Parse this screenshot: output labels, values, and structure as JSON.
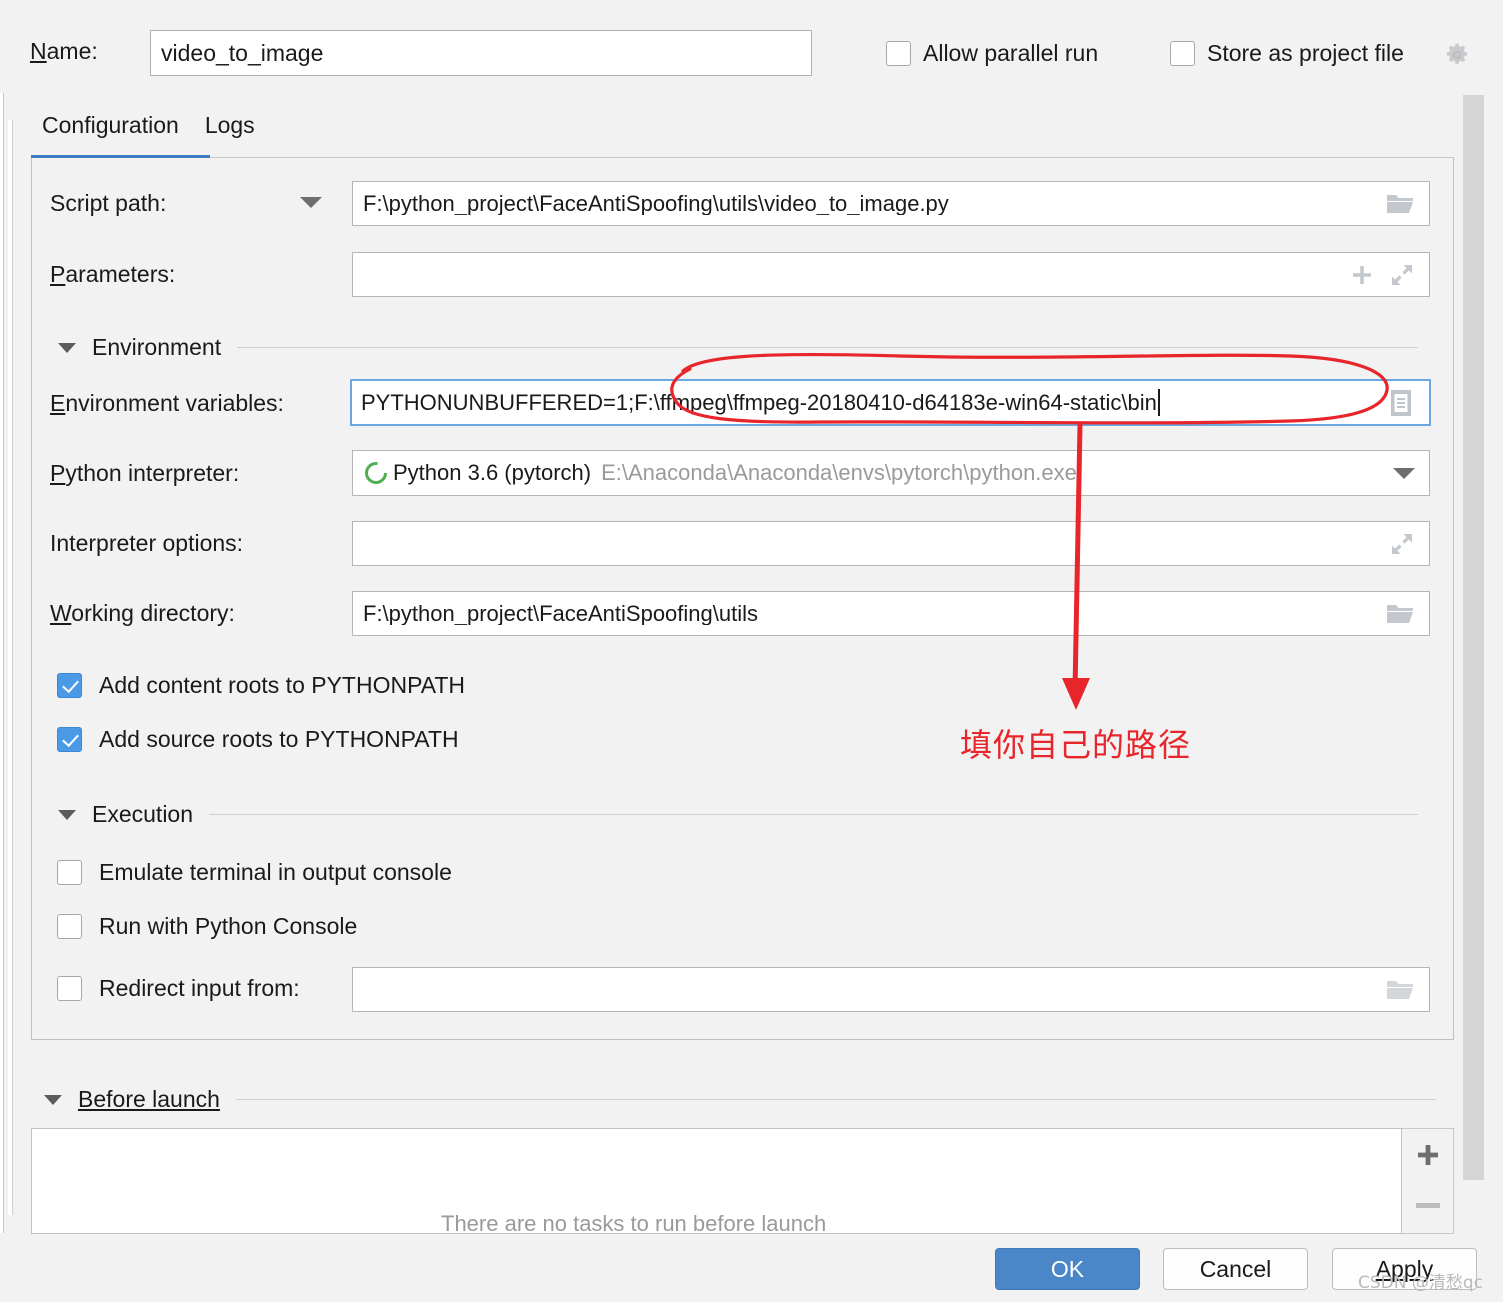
{
  "dialog": {
    "name_label": "Name:",
    "name_value": "video_to_image",
    "allow_parallel_run": "Allow parallel run",
    "store_as_project_file": "Store as project file",
    "gear_icon": "gear-icon"
  },
  "tabs": [
    {
      "label": "Configuration",
      "active": true
    },
    {
      "label": "Logs",
      "active": false
    }
  ],
  "fields": {
    "script_path_label": "Script path:",
    "script_path_value": "F:\\python_project\\FaceAntiSpoofing\\utils\\video_to_image.py",
    "parameters_label": "Parameters:",
    "parameters_value": "",
    "env_vars_label": "Environment variables:",
    "env_vars_value": "PYTHONUNBUFFERED=1;F:\\ffmpeg\\ffmpeg-20180410-d64183e-win64-static\\bin",
    "interpreter_label": "Python interpreter:",
    "interpreter_name": "Python 3.6 (pytorch)",
    "interpreter_path": "E:\\Anaconda\\Anaconda\\envs\\pytorch\\python.exe",
    "interpreter_options_label": "Interpreter options:",
    "interpreter_options_value": "",
    "working_directory_label": "Working directory:",
    "working_directory_value": "F:\\python_project\\FaceAntiSpoofing\\utils",
    "redirect_input_label": "Redirect input from:",
    "redirect_input_value": ""
  },
  "sections": {
    "environment": "Environment",
    "execution": "Execution",
    "before_launch": "Before launch"
  },
  "checkboxes": {
    "add_content_roots": {
      "label": "Add content roots to PYTHONPATH",
      "checked": true
    },
    "add_source_roots": {
      "label": "Add source roots to PYTHONPATH",
      "checked": true
    },
    "emulate_terminal": {
      "label": "Emulate terminal in output console",
      "checked": false
    },
    "run_with_python_console": {
      "label": "Run with Python Console",
      "checked": false
    }
  },
  "before_launch": {
    "ghost_text": "There are no tasks to run before launch"
  },
  "buttons": {
    "ok": "OK",
    "cancel": "Cancel",
    "apply": "Apply"
  },
  "annotations": {
    "note_text": "填你自己的路径",
    "note_color": "#e8252a",
    "watermark": "CSDN @清愁qc"
  },
  "colors": {
    "accent": "#3d7dc0",
    "ok_button": "#4a86c8",
    "checkbox_checked": "#4a9ae8",
    "focus_border": "#6ba7e0",
    "annotation_red": "#e8252a",
    "background": "#f2f2f2"
  }
}
